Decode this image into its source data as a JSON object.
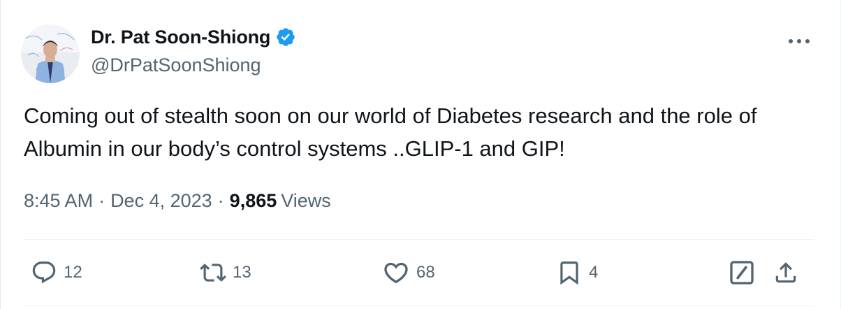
{
  "author": {
    "display_name": "Dr. Pat Soon-Shiong",
    "handle": "@DrPatSoonShiong",
    "verified": true,
    "verified_color": "#1d9bf0"
  },
  "tweet": {
    "text": "Coming out of stealth soon on our world of Diabetes research and the role of Albumin in our body’s control systems ..GLIP-1 and GIP!",
    "time": "8:45 AM",
    "date": "Dec 4, 2023",
    "separator": "·",
    "views_count": "9,865",
    "views_label": "Views"
  },
  "actions": {
    "replies": "12",
    "reposts": "13",
    "likes": "68",
    "bookmarks": "4"
  },
  "icons": {
    "reply": "reply-icon",
    "repost": "repost-icon",
    "like": "heart-icon",
    "bookmark": "bookmark-icon",
    "grok": "grok-icon",
    "share": "share-icon",
    "more": "more-icon"
  },
  "colors": {
    "text_primary": "#0f1419",
    "text_secondary": "#536471",
    "divider": "#eff3f4",
    "accent": "#1d9bf0"
  }
}
